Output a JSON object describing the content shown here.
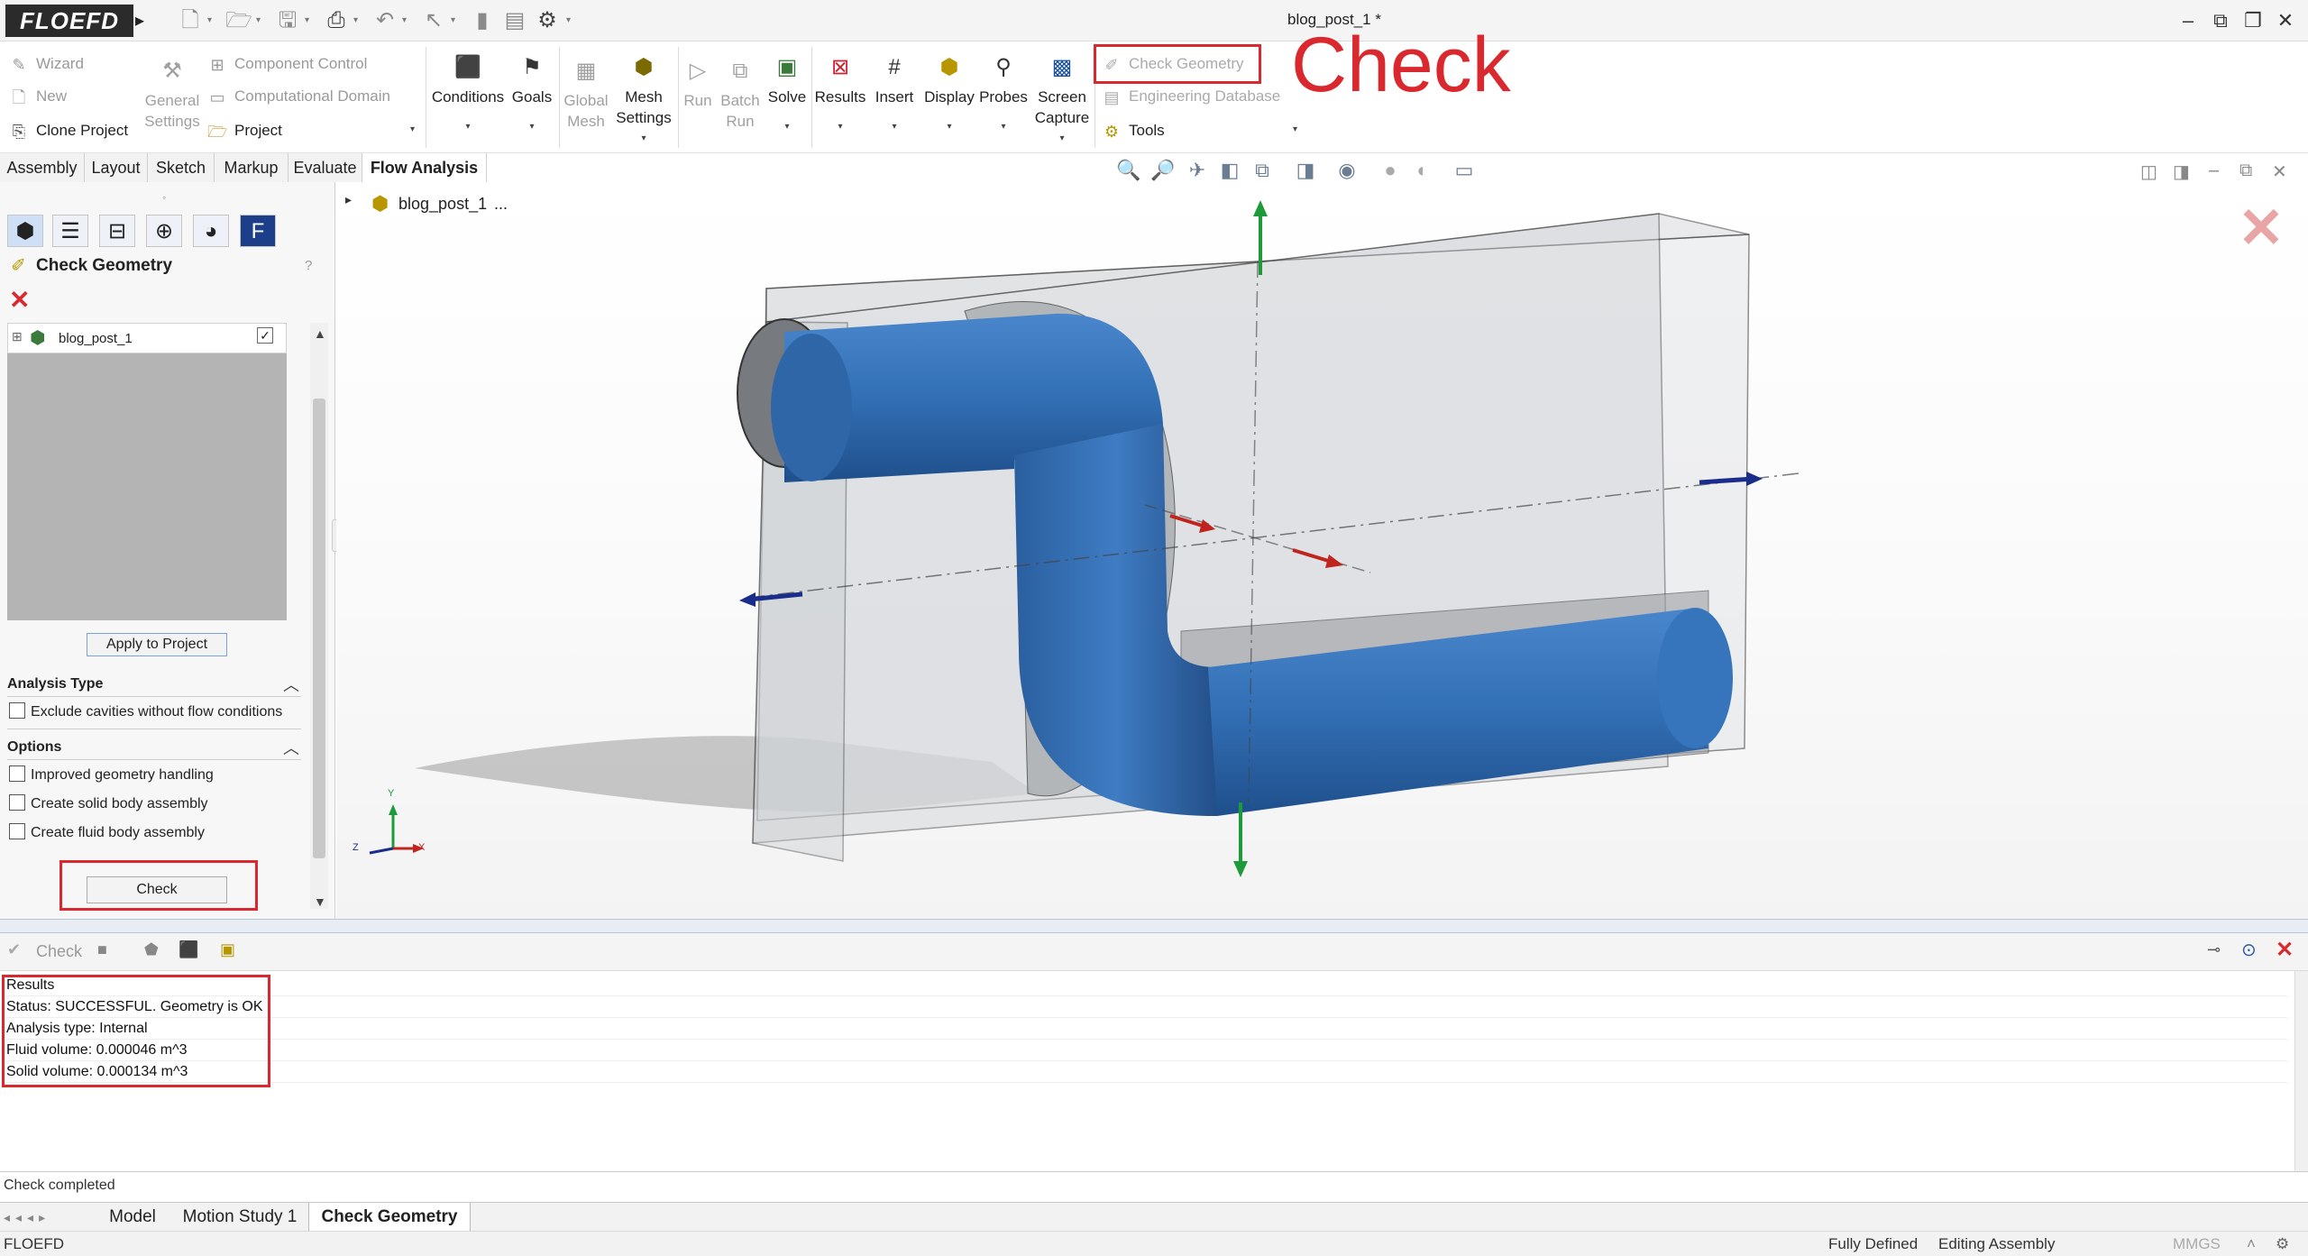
{
  "app": {
    "logo": "FLOEFD",
    "document_title": "blog_post_1 *"
  },
  "ribbon": {
    "wizard": "Wizard",
    "new": "New",
    "clone_project": "Clone Project",
    "general_settings_line1": "General",
    "general_settings_line2": "Settings",
    "component_control": "Component Control",
    "computational_domain": "Computational Domain",
    "project": "Project",
    "conditions": "Conditions",
    "goals": "Goals",
    "global_mesh_line1": "Global",
    "global_mesh_line2": "Mesh",
    "mesh_settings_line1": "Mesh",
    "mesh_settings_line2": "Settings",
    "run": "Run",
    "batch_run_line1": "Batch",
    "batch_run_line2": "Run",
    "solve": "Solve",
    "results": "Results",
    "insert": "Insert",
    "display": "Display",
    "probes": "Probes",
    "screen_capture_line1": "Screen",
    "screen_capture_line2": "Capture",
    "check_geometry": "Check Geometry",
    "engineering_database": "Engineering Database",
    "tools": "Tools"
  },
  "annotation": {
    "check_label": "Check"
  },
  "command_tabs": [
    "Assembly",
    "Layout",
    "Sketch",
    "Markup",
    "Evaluate",
    "Flow Analysis"
  ],
  "left_panel": {
    "title": "Check Geometry",
    "help": "?",
    "tree_item": "blog_post_1",
    "apply_button": "Apply to Project",
    "analysis_type": {
      "title": "Analysis Type",
      "options": [
        "Exclude cavities without flow conditions"
      ]
    },
    "options": {
      "title": "Options",
      "items": [
        "Improved geometry handling",
        "Create solid body assembly",
        "Create fluid body assembly"
      ]
    },
    "check_button": "Check"
  },
  "viewport": {
    "breadcrumb": "blog_post_1",
    "ellipsis": "...",
    "triad": {
      "x": "X",
      "y": "Y",
      "z": "Z"
    }
  },
  "bottom_panel": {
    "toolbar_check": "Check",
    "results": [
      "Results",
      "Status: SUCCESSFUL. Geometry is OK",
      "Analysis type: Internal",
      "Fluid volume: 0.000046 m^3",
      "Solid volume: 0.000134 m^3"
    ],
    "status": "Check completed"
  },
  "bottom_tabs": [
    "Model",
    "Motion Study 1",
    "Check Geometry"
  ],
  "status_bar": {
    "left": "FLOEFD",
    "fully_defined": "Fully Defined",
    "editing": "Editing Assembly",
    "units": "MMGS"
  }
}
